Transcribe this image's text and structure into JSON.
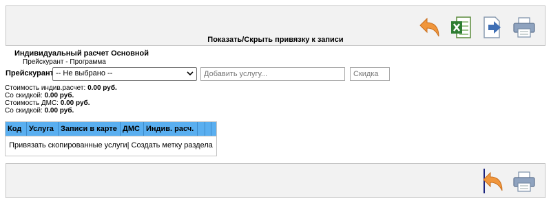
{
  "toolbar": {
    "icons": [
      "undo-arrow-icon",
      "excel-icon",
      "export-icon",
      "printer-icon"
    ],
    "toggle_link": "Показать/Скрыть привязку к записи"
  },
  "calc": {
    "title": "Индивидуальный расчет Основной",
    "subtitle": "Прейскурант - Программа"
  },
  "pricelist": {
    "label": "Прейскурант",
    "selected": "-- Не выбрано --",
    "service_placeholder": "Добавить услугу...",
    "discount_placeholder": "Скидка"
  },
  "costs": [
    {
      "label": "Стоимость индив.расчет:",
      "value": "0.00 руб."
    },
    {
      "label": "Со скидкой:",
      "value": "0.00 руб."
    },
    {
      "label": "Стоимость ДМС:",
      "value": "0.00 руб."
    },
    {
      "label": "Со скидкой:",
      "value": "0.00 руб."
    }
  ],
  "grid": {
    "columns": [
      "Код",
      "Услуга",
      "Записи в карте",
      "ДМС",
      "Индив. расч.",
      "",
      ""
    ],
    "action_bind": "Привязать скопированные услуги",
    "separator": "|",
    "action_mark": "Создать метку раздела"
  },
  "colors": {
    "header_blue": "#5aaff0",
    "panel_bg": "#f2f2f2",
    "undo_orange": "#f0963c"
  }
}
